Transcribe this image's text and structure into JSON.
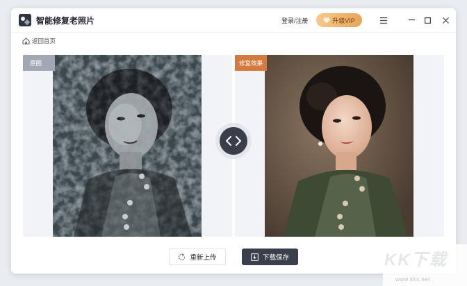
{
  "app": {
    "title": "智能修复老照片"
  },
  "header": {
    "login_label": "登录/注册",
    "vip_label": "升级VIP",
    "colors": {
      "vip_start": "#f7c98b",
      "vip_end": "#e9a45a"
    }
  },
  "nav": {
    "back_label": "返回首页"
  },
  "panels": {
    "original_tag": "原图",
    "fixed_tag": "修复效果",
    "colors": {
      "original_tag_bg": "#a2a8b3",
      "fixed_tag_bg": "#d57a3e"
    }
  },
  "actions": {
    "reupload_label": "重新上传",
    "download_label": "下载保存"
  },
  "watermark": {
    "main": "KK下载",
    "url": "www.kkx.net"
  }
}
